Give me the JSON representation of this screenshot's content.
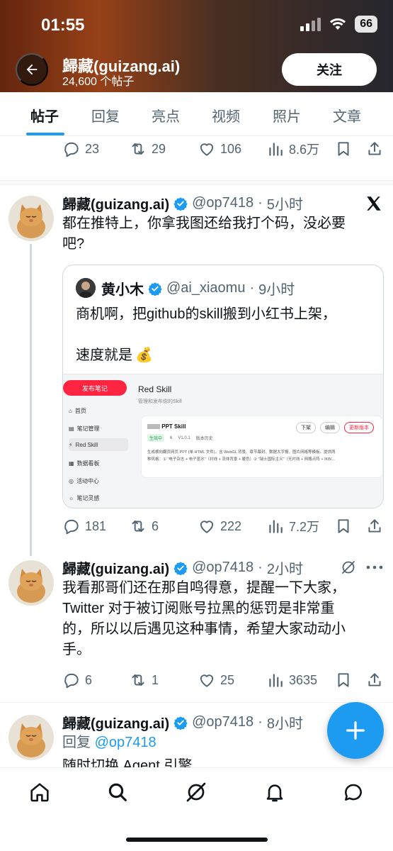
{
  "status": {
    "time": "01:55",
    "battery": "66"
  },
  "header": {
    "name": "歸藏(guizang.ai)",
    "post_count": "24,600 个帖子",
    "follow_label": "关注"
  },
  "tabs": [
    "帖子",
    "回复",
    "亮点",
    "视频",
    "照片",
    "文章"
  ],
  "top_actions": {
    "replies": "23",
    "reposts": "29",
    "likes": "106",
    "views": "8.6万"
  },
  "post1": {
    "name": "歸藏(guizang.ai)",
    "handle": "@op7418",
    "time": "5小时",
    "text_line1": "都在推特上，你拿我图还给我打个码，没必要",
    "text_line2": "吧?",
    "quote": {
      "name": "黄小木",
      "handle": "@ai_xiaomu",
      "time": "9小时",
      "text_line1": "商机啊，把github的skill搬到小红书上架，",
      "text_line2": "速度就是",
      "emoji": "💰",
      "shot": {
        "publish_label": "发布笔记",
        "sidebar": [
          "首页",
          "笔记管理",
          "Red Skill",
          "数据看板",
          "活动中心",
          "笔记灵感"
        ],
        "title": "Red Skill",
        "subtitle": "管理和发布你的Skill",
        "card_title": "PPT Skill",
        "card_status": "生效中",
        "card_meta_downloads": "6",
        "card_meta_version": "V1.0.1",
        "card_meta_history": "版本历史",
        "btn_down": "下架",
        "btn_edit": "编辑",
        "btn_update": "更新版本",
        "card_desc1": "生成横向翻页网页 PPT (单 HTML 文件)，含 WebGL 背景、章节幕封、数据大字报、图片网格等模板。提供两",
        "card_desc2": "种风格：① \"电子杂志 + 电子墨水\"（衬线 + 流体背景 + 暖色）② \"瑞士国际主义\"（无衬线 + 网格点阵 + IKB/..."
      }
    },
    "actions": {
      "replies": "181",
      "reposts": "6",
      "likes": "222",
      "views": "7.2万"
    }
  },
  "post2": {
    "name": "歸藏(guizang.ai)",
    "handle": "@op7418",
    "time": "2小时",
    "lines": [
      "我看那哥们还在那自鸣得意，提醒一下大家，",
      "Twitter 对于被订阅账号拉黑的惩罚是非常重",
      "的，所以以后遇见这种事情，希望大家动动小",
      "手。"
    ],
    "actions": {
      "replies": "6",
      "reposts": "1",
      "likes": "25",
      "views": "3635"
    }
  },
  "post3": {
    "name": "歸藏(guizang.ai)",
    "handle": "@op7418",
    "time": "8小时",
    "reply_prefix": "回复",
    "reply_to": "@op7418",
    "cut_text": "随时切换 Agent 引擎"
  },
  "colors": {
    "accent": "#1d9bf0",
    "text": "#0f1419",
    "muted": "#536471"
  }
}
